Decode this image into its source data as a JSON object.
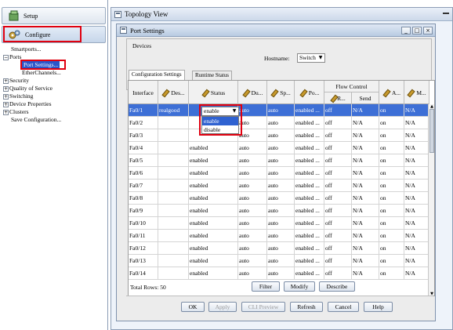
{
  "nav": {
    "setup_label": "Setup",
    "configure_label": "Configure",
    "tree": [
      {
        "label": "Smartports...",
        "level": 1,
        "expander": ""
      },
      {
        "label": "Ports",
        "level": 0,
        "expander": "−"
      },
      {
        "label": "Port Settings...",
        "level": 2,
        "expander": "",
        "selected": true
      },
      {
        "label": "EtherChannels...",
        "level": 2,
        "expander": ""
      },
      {
        "label": "Security",
        "level": 0,
        "expander": "+"
      },
      {
        "label": "Quality of Service",
        "level": 0,
        "expander": "+"
      },
      {
        "label": "Switching",
        "level": 0,
        "expander": "+"
      },
      {
        "label": "Device Properties",
        "level": 0,
        "expander": "+"
      },
      {
        "label": "Clusters",
        "level": 0,
        "expander": "+"
      },
      {
        "label": "Save Configuration...",
        "level": 1,
        "expander": ""
      }
    ]
  },
  "topology": {
    "title": "Topology View"
  },
  "port_settings": {
    "title": "Port Settings",
    "devices_label": "Devices",
    "hostname_label": "Hostname:",
    "hostname_value": "Switch",
    "tabs": [
      "Configuration Settings",
      "Runtime Status"
    ],
    "headers": {
      "interface": "Interface",
      "description": "Des...",
      "status": "Status",
      "duplex": "Du...",
      "speed": "Sp...",
      "port": "Po...",
      "flow_control": "Flow Control",
      "flow_receive": "R...",
      "flow_send": "Send",
      "a": "A...",
      "m": "M..."
    },
    "status_combo_value": "enable",
    "status_options": [
      "enable",
      "disable"
    ],
    "rows": [
      {
        "interface": "Fa0/1",
        "description": "realgood",
        "status": "",
        "duplex": "auto",
        "speed": "auto",
        "port": "enabled ...",
        "receive": "off",
        "send": "N/A",
        "a": "on",
        "m": "N/A"
      },
      {
        "interface": "Fa0/2",
        "description": "",
        "status": "",
        "duplex": "auto",
        "speed": "auto",
        "port": "enabled ...",
        "receive": "off",
        "send": "N/A",
        "a": "on",
        "m": "N/A"
      },
      {
        "interface": "Fa0/3",
        "description": "",
        "status": "",
        "duplex": "auto",
        "speed": "auto",
        "port": "enabled ...",
        "receive": "off",
        "send": "N/A",
        "a": "on",
        "m": "N/A"
      },
      {
        "interface": "Fa0/4",
        "description": "",
        "status": "enabled",
        "duplex": "auto",
        "speed": "auto",
        "port": "enabled ...",
        "receive": "off",
        "send": "N/A",
        "a": "on",
        "m": "N/A"
      },
      {
        "interface": "Fa0/5",
        "description": "",
        "status": "enabled",
        "duplex": "auto",
        "speed": "auto",
        "port": "enabled ...",
        "receive": "off",
        "send": "N/A",
        "a": "on",
        "m": "N/A"
      },
      {
        "interface": "Fa0/6",
        "description": "",
        "status": "enabled",
        "duplex": "auto",
        "speed": "auto",
        "port": "enabled ...",
        "receive": "off",
        "send": "N/A",
        "a": "on",
        "m": "N/A"
      },
      {
        "interface": "Fa0/7",
        "description": "",
        "status": "enabled",
        "duplex": "auto",
        "speed": "auto",
        "port": "enabled ...",
        "receive": "off",
        "send": "N/A",
        "a": "on",
        "m": "N/A"
      },
      {
        "interface": "Fa0/8",
        "description": "",
        "status": "enabled",
        "duplex": "auto",
        "speed": "auto",
        "port": "enabled ...",
        "receive": "off",
        "send": "N/A",
        "a": "on",
        "m": "N/A"
      },
      {
        "interface": "Fa0/9",
        "description": "",
        "status": "enabled",
        "duplex": "auto",
        "speed": "auto",
        "port": "enabled ...",
        "receive": "off",
        "send": "N/A",
        "a": "on",
        "m": "N/A"
      },
      {
        "interface": "Fa0/10",
        "description": "",
        "status": "enabled",
        "duplex": "auto",
        "speed": "auto",
        "port": "enabled ...",
        "receive": "off",
        "send": "N/A",
        "a": "on",
        "m": "N/A"
      },
      {
        "interface": "Fa0/11",
        "description": "",
        "status": "enabled",
        "duplex": "auto",
        "speed": "auto",
        "port": "enabled ...",
        "receive": "off",
        "send": "N/A",
        "a": "on",
        "m": "N/A"
      },
      {
        "interface": "Fa0/12",
        "description": "",
        "status": "enabled",
        "duplex": "auto",
        "speed": "auto",
        "port": "enabled ...",
        "receive": "off",
        "send": "N/A",
        "a": "on",
        "m": "N/A"
      },
      {
        "interface": "Fa0/13",
        "description": "",
        "status": "enabled",
        "duplex": "auto",
        "speed": "auto",
        "port": "enabled ...",
        "receive": "off",
        "send": "N/A",
        "a": "on",
        "m": "N/A"
      },
      {
        "interface": "Fa0/14",
        "description": "",
        "status": "enabled",
        "duplex": "auto",
        "speed": "auto",
        "port": "enabled ...",
        "receive": "off",
        "send": "N/A",
        "a": "on",
        "m": "N/A"
      }
    ],
    "total_rows": "Total Rows: 50",
    "table_buttons": [
      "Filter",
      "Modify",
      "Describe"
    ],
    "footer_buttons": [
      {
        "label": "OK",
        "enabled": true
      },
      {
        "label": "Apply",
        "enabled": false
      },
      {
        "label": "CLI Preview",
        "enabled": false
      },
      {
        "label": "Refresh",
        "enabled": true
      },
      {
        "label": "Cancel",
        "enabled": true
      },
      {
        "label": "Help",
        "enabled": true
      }
    ]
  },
  "colors": {
    "highlight_box": "#e0000f",
    "selected_row": "#3d6fd6",
    "tree_selection": "#2a55c9"
  }
}
